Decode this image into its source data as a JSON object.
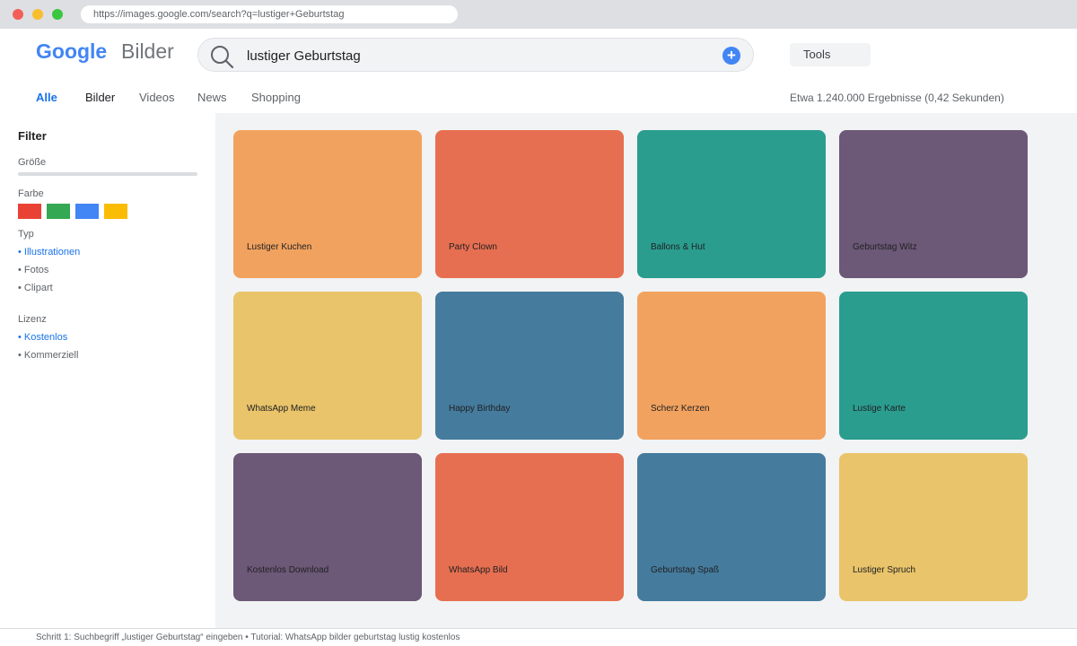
{
  "browser": {
    "url": "https://images.google.com/search?q=lustiger+Geburtstag"
  },
  "header": {
    "logo": "Google",
    "logo_sub": "Bilder",
    "search_value": "lustiger Geburtstag",
    "plus_label": "+",
    "tools_label": "Tools"
  },
  "tabs": [
    {
      "label": "Alle"
    },
    {
      "label": "Bilder"
    },
    {
      "label": "Videos"
    },
    {
      "label": "News"
    },
    {
      "label": "Shopping"
    }
  ],
  "results_info": "Etwa 1.240.000 Ergebnisse (0,42 Sekunden)",
  "sidebar": {
    "title": "Filter",
    "size_label": "Größe",
    "color_label": "Farbe",
    "swatches": [
      "#e94235",
      "#34a853",
      "#4285f4",
      "#fbbc05"
    ],
    "type_label": "Typ",
    "type_items": [
      "• Illustrationen",
      "• Fotos",
      "• Clipart"
    ],
    "license_label": "Lizenz",
    "license_items": [
      "• Kostenlos",
      "• Kommerziell"
    ]
  },
  "results": [
    {
      "label": "Lustiger Kuchen",
      "color": "#f2a25f"
    },
    {
      "label": "Party Clown",
      "color": "#e76f51"
    },
    {
      "label": "Ballons & Hut",
      "color": "#2a9d8f"
    },
    {
      "label": "Geburtstag Witz",
      "color": "#6c5877"
    },
    {
      "label": "WhatsApp Meme",
      "color": "#e9c46a"
    },
    {
      "label": "Happy Birthday",
      "color": "#457b9d"
    },
    {
      "label": "Scherz Kerzen",
      "color": "#f2a25f"
    },
    {
      "label": "Lustige Karte",
      "color": "#2a9d8f"
    },
    {
      "label": "Kostenlos Download",
      "color": "#6c5877"
    },
    {
      "label": "WhatsApp Bild",
      "color": "#e76f51"
    },
    {
      "label": "Geburtstag Spaß",
      "color": "#457b9d"
    },
    {
      "label": "Lustiger Spruch",
      "color": "#e9c46a"
    }
  ],
  "footer": "Schritt 1: Suchbegriff „lustiger Geburtstag“ eingeben • Tutorial: WhatsApp bilder geburtstag lustig kostenlos"
}
